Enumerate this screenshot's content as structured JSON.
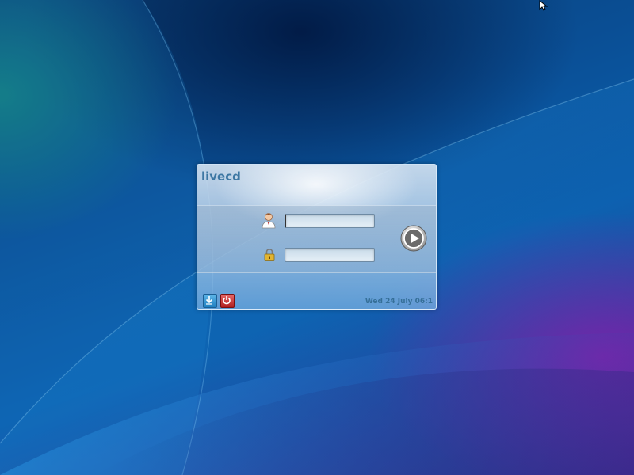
{
  "login": {
    "hostname": "livecd",
    "username_value": "",
    "password_value": "",
    "clock": "Wed 24 July 06:1"
  },
  "icons": {
    "user": "user-icon",
    "password": "padlock-icon",
    "login": "play-arrow-icon",
    "menu": "down-arrow-icon",
    "shutdown": "power-icon",
    "cursor": "mouse-pointer-icon"
  },
  "colors": {
    "panel_text": "#3d77a3",
    "clock_text": "#356f98",
    "menu_button": "#1f7fc0",
    "shutdown_button": "#b01f1f"
  }
}
